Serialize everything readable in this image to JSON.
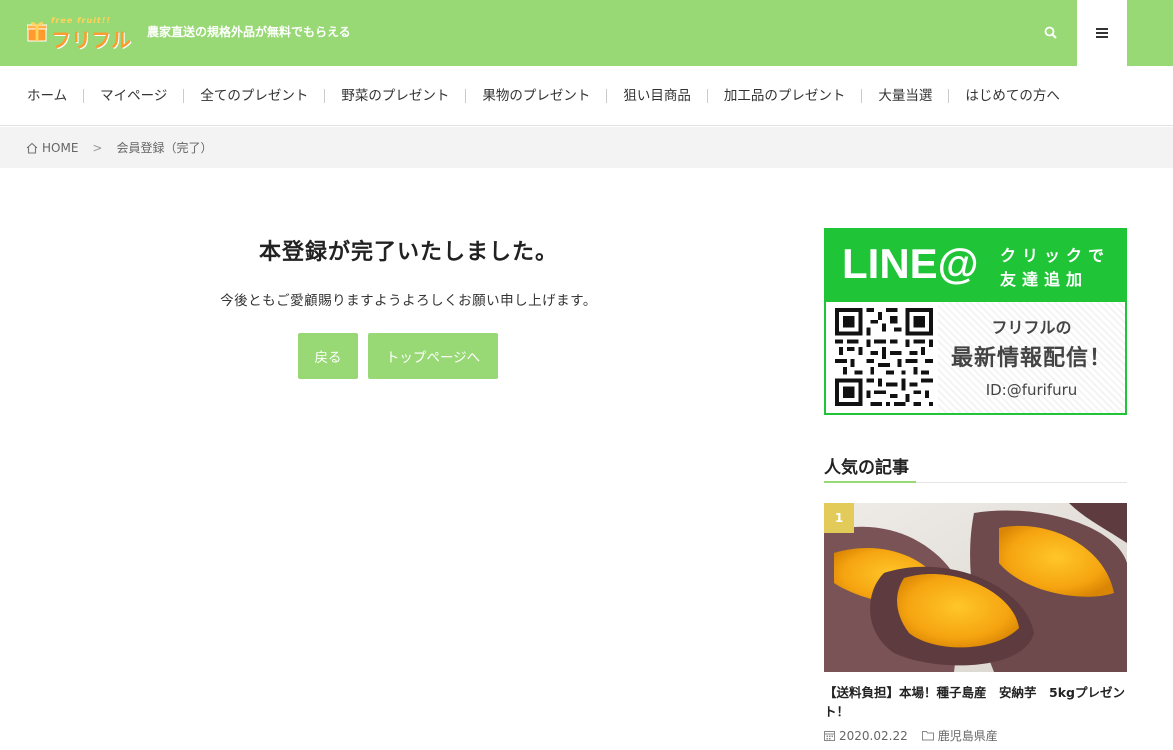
{
  "header": {
    "logo_tagline": "free fruit!!",
    "logo_name": "フリフル",
    "site_description": "農家直送の規格外品が無料でもらえる",
    "search_icon": "search-icon",
    "menu_icon": "hamburger-menu-icon",
    "bg_color": "#98d975"
  },
  "nav": {
    "items": [
      "ホーム",
      "マイページ",
      "全てのプレゼント",
      "野菜のプレゼント",
      "果物のプレゼント",
      "狙い目商品",
      "加工品のプレゼント",
      "大量当選",
      "はじめての方へ"
    ]
  },
  "breadcrumb": {
    "home_icon": "home-icon",
    "home": "HOME",
    "separator": ">",
    "current": "会員登録（完了）"
  },
  "main": {
    "title": "本登録が完了いたしました。",
    "message": "今後ともご愛顧賜りますようよろしくお願い申し上げます。",
    "back_button": "戻る",
    "top_button": "トップページへ",
    "button_color": "#98d975"
  },
  "sidebar": {
    "line_banner": {
      "logo": "LINE@",
      "click_text": "クリックで",
      "add_text": "友達追加",
      "sub_text": "フリフルの",
      "main_text": "最新情報配信！",
      "id_text": "ID:@furifuru",
      "color": "#1fc437"
    },
    "popular_title": "人気の記事",
    "posts": [
      {
        "rank": "1",
        "title": "【送料負担】本場！種子島産　安納芋　5kgプレゼント！",
        "date": "2020.02.22",
        "category": "鹿児島県産",
        "date_icon": "calendar-icon",
        "category_icon": "folder-icon"
      }
    ]
  }
}
